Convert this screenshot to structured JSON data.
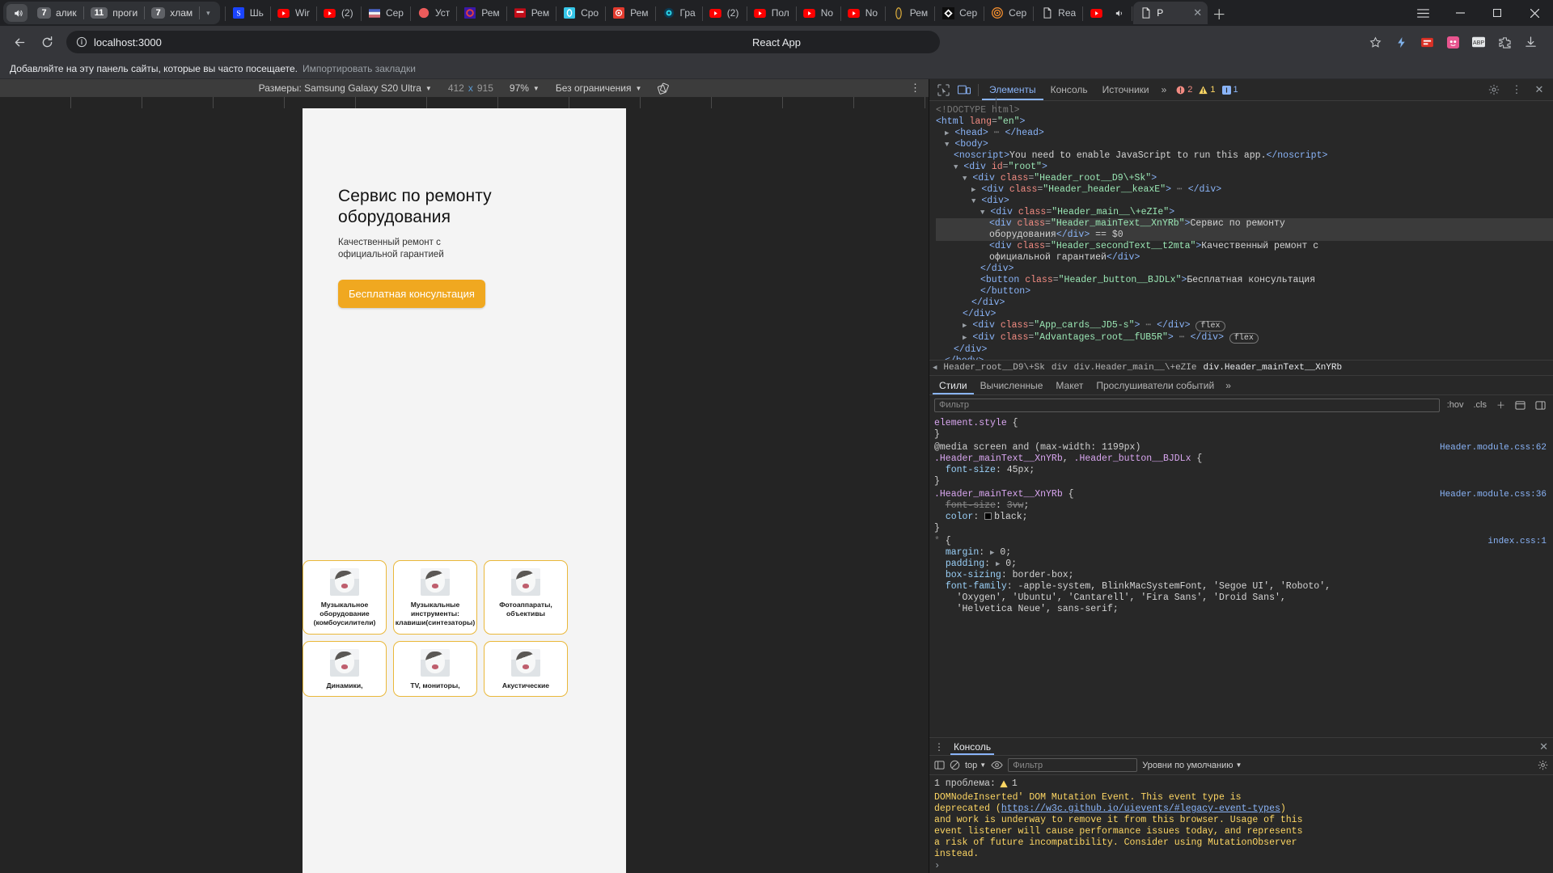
{
  "browser": {
    "tab_group": {
      "icon": "audio-playing-icon",
      "items": [
        {
          "count": "7",
          "label": "алик"
        },
        {
          "count": "11",
          "label": "проги"
        },
        {
          "count": "7",
          "label": "хлам"
        }
      ],
      "collapse_icon": "chevron-down-icon"
    },
    "tabs": [
      {
        "title": "Шь",
        "favicon": "s-blue-icon"
      },
      {
        "title": "Wir",
        "favicon": "youtube-icon"
      },
      {
        "title": "(2)",
        "favicon": "youtube-icon"
      },
      {
        "title": "Сер",
        "favicon": "flag-icon"
      },
      {
        "title": "Уст",
        "favicon": "red-dot-icon"
      },
      {
        "title": "Рем",
        "favicon": "purple-c-icon"
      },
      {
        "title": "Рем",
        "favicon": "red-square-icon"
      },
      {
        "title": "Сро",
        "favicon": "cyan-o-icon"
      },
      {
        "title": "Рем",
        "favicon": "red-circle-icon"
      },
      {
        "title": "Гра",
        "favicon": "teal-orb-icon"
      },
      {
        "title": "(2)",
        "favicon": "youtube-icon"
      },
      {
        "title": "Пол",
        "favicon": "youtube-icon"
      },
      {
        "title": "Nо",
        "favicon": "youtube-icon"
      },
      {
        "title": "Nо",
        "favicon": "youtube-icon"
      },
      {
        "title": "Рем",
        "favicon": "gold-ring-icon"
      },
      {
        "title": "Сер",
        "favicon": "black-diamond-icon"
      },
      {
        "title": "Сер",
        "favicon": "orange-target-icon"
      },
      {
        "title": "Rea",
        "favicon": "document-icon"
      },
      {
        "title": "",
        "favicon": "youtube-icon",
        "audio": "speaker-icon"
      }
    ],
    "active_tab": {
      "title": "Р",
      "favicon": "document-icon",
      "close_icon": "close-icon"
    },
    "new_tab_icon": "plus-icon",
    "window_controls": {
      "menu_icon": "hamburger-menu-icon",
      "minimize_icon": "minimize-icon",
      "maximize_icon": "maximize-icon",
      "close_icon": "close-window-icon"
    },
    "nav": {
      "back_icon": "arrow-left-icon",
      "reload_icon": "reload-icon",
      "info_icon": "page-info-icon",
      "url": "localhost:3000",
      "page_title": "React App",
      "right_icons": [
        "bookmark-star-icon",
        "extension-flash-icon",
        "extension-red-icon",
        "extension-pink-icon",
        "abp-icon",
        "extension-puzzle-icon",
        "download-icon"
      ]
    },
    "bookmark_bar": {
      "text": "Добавляйте на эту панель сайты, которые вы часто посещаете.",
      "link": "Импортировать закладки"
    }
  },
  "device_toolbar": {
    "dimensions_label": "Размеры: Samsung Galaxy S20 Ultra",
    "dimensions_caret": "chevron-down-icon",
    "width": "412",
    "x": "x",
    "height": "915",
    "zoom": "97%",
    "zoom_caret": "chevron-down-icon",
    "throttling": "Без ограничения",
    "throttling_caret": "chevron-down-icon",
    "rotate_icon": "rotate-device-icon",
    "kebab_icon": "more-options-icon"
  },
  "page": {
    "hero": {
      "title": "Сервис по ремонту оборудования",
      "subtitle": "Качественный ремонт с официальной гарантией",
      "cta_label": "Бесплатная консультация",
      "cta_color": "#f0a820"
    },
    "cards": [
      {
        "caption": "Музыкальное оборудование (комбоусилители)",
        "image": "cat-thumbnail"
      },
      {
        "caption": "Музыкальные инструменты: клавиши(синтезаторы)",
        "image": "cat-thumbnail"
      },
      {
        "caption": "Фотоаппараты, объективы",
        "image": "cat-thumbnail"
      },
      {
        "caption": "Динамики,",
        "image": "cat-thumbnail"
      },
      {
        "caption": "TV, мониторы,",
        "image": "cat-thumbnail"
      },
      {
        "caption": "Акустические",
        "image": "cat-thumbnail"
      }
    ]
  },
  "devtools": {
    "inspect_icon": "inspect-element-icon",
    "device_icon": "toggle-device-toolbar-icon",
    "tabs": [
      {
        "label": "Элементы",
        "selected": true
      },
      {
        "label": "Консоль",
        "selected": false
      },
      {
        "label": "Источники",
        "selected": false
      }
    ],
    "more_tabs_icon": "chevron-right-icon",
    "counts": {
      "errors": "2",
      "warnings": "1",
      "info": "1"
    },
    "settings_icon": "gear-icon",
    "kebab_icon": "more-options-icon",
    "close_icon": "close-icon",
    "dom": [
      {
        "indent": 0,
        "html": "<span class=\"gr\">&lt;!DOCTYPE html&gt;</span>"
      },
      {
        "indent": 0,
        "html": "<span class=\"tg\">&lt;html</span> <span class=\"at\">lang</span>=<span class=\"av\">\"en\"</span><span class=\"tg\">&gt;</span>"
      },
      {
        "indent": 1,
        "html": "<span class=\"caret\">▶</span> <span class=\"tg\">&lt;head&gt;</span> <span class=\"gr\">⋯</span> <span class=\"tg\">&lt;/head&gt;</span>"
      },
      {
        "indent": 1,
        "html": "<span class=\"caret\">▼</span> <span class=\"tg\">&lt;body&gt;</span>"
      },
      {
        "indent": 2,
        "html": "<span class=\"tg\">&lt;noscript&gt;</span><span class=\"tx\">You need to enable JavaScript to run this app.</span><span class=\"tg\">&lt;/noscript&gt;</span>"
      },
      {
        "indent": 2,
        "html": "<span class=\"caret\">▼</span> <span class=\"tg\">&lt;div</span> <span class=\"at\">id</span>=<span class=\"av\">\"root\"</span><span class=\"tg\">&gt;</span>"
      },
      {
        "indent": 3,
        "html": "<span class=\"caret\">▼</span> <span class=\"tg\">&lt;div</span> <span class=\"at\">class</span>=<span class=\"av\">\"Header_root__D9\\+Sk\"</span><span class=\"tg\">&gt;</span>"
      },
      {
        "indent": 4,
        "html": "<span class=\"caret\">▶</span> <span class=\"tg\">&lt;div</span> <span class=\"at\">class</span>=<span class=\"av\">\"Header_header__keaxE\"</span><span class=\"tg\">&gt;</span> <span class=\"gr\">⋯</span> <span class=\"tg\">&lt;/div&gt;</span>"
      },
      {
        "indent": 4,
        "html": "<span class=\"caret\">▼</span> <span class=\"tg\">&lt;div&gt;</span>"
      },
      {
        "indent": 5,
        "html": "<span class=\"caret\">▼</span> <span class=\"tg\">&lt;div</span> <span class=\"at\">class</span>=<span class=\"av\">\"Header_main__\\+eZIe\"</span><span class=\"tg\">&gt;</span>"
      },
      {
        "indent": 6,
        "selected": true,
        "html": "<span class=\"tg\">&lt;div</span> <span class=\"at\">class</span>=<span class=\"av\">\"Header_mainText__XnYRb\"</span><span class=\"tg\">&gt;</span><span class=\"tx\">Сервис по ремонту</span>"
      },
      {
        "indent": 6,
        "selected": true,
        "html": "<span class=\"tx\">оборудования</span><span class=\"tg\">&lt;/div&gt;</span> <span class=\"eqsel\">== $0</span>"
      },
      {
        "indent": 6,
        "html": "<span class=\"tg\">&lt;div</span> <span class=\"at\">class</span>=<span class=\"av\">\"Header_secondText__t2mta\"</span><span class=\"tg\">&gt;</span><span class=\"tx\">Качественный ремонт с</span>"
      },
      {
        "indent": 6,
        "html": "<span class=\"tx\">официальной гарантией</span><span class=\"tg\">&lt;/div&gt;</span>"
      },
      {
        "indent": 5,
        "html": "<span class=\"tg\">&lt;/div&gt;</span>"
      },
      {
        "indent": 5,
        "html": "<span class=\"tg\">&lt;button</span> <span class=\"at\">class</span>=<span class=\"av\">\"Header_button__BJDLx\"</span><span class=\"tg\">&gt;</span><span class=\"tx\">Бесплатная консультация</span>"
      },
      {
        "indent": 5,
        "html": "<span class=\"tg\">&lt;/button&gt;</span>"
      },
      {
        "indent": 4,
        "html": "<span class=\"tg\">&lt;/div&gt;</span>"
      },
      {
        "indent": 3,
        "html": "<span class=\"tg\">&lt;/div&gt;</span>"
      },
      {
        "indent": 3,
        "html": "<span class=\"caret\">▶</span> <span class=\"tg\">&lt;div</span> <span class=\"at\">class</span>=<span class=\"av\">\"App_cards__JD5-s\"</span><span class=\"tg\">&gt;</span> <span class=\"gr\">⋯</span> <span class=\"tg\">&lt;/div&gt;</span> <span class=\"flexchip\">flex</span>"
      },
      {
        "indent": 3,
        "html": "<span class=\"caret\">▶</span> <span class=\"tg\">&lt;div</span> <span class=\"at\">class</span>=<span class=\"av\">\"Advantages_root__fUB5R\"</span><span class=\"tg\">&gt;</span> <span class=\"gr\">⋯</span> <span class=\"tg\">&lt;/div&gt;</span> <span class=\"flexchip\">flex</span>"
      },
      {
        "indent": 2,
        "html": "<span class=\"tg\">&lt;/div&gt;</span>"
      },
      {
        "indent": 1,
        "html": "<span class=\"tg\">&lt;/body&gt;</span>"
      }
    ],
    "breadcrumbs": [
      "Header_root__D9\\+Sk",
      "div",
      "div.Header_main__\\+eZIe",
      "div.Header_mainText__XnYRb"
    ],
    "styles_tabs": [
      {
        "label": "Стили",
        "selected": true
      },
      {
        "label": "Вычисленные",
        "selected": false
      },
      {
        "label": "Макет",
        "selected": false
      },
      {
        "label": "Прослушиватели событий",
        "selected": false
      }
    ],
    "styles_more_icon": "chevron-right-icon",
    "filter_placeholder": "Фильтр",
    "filter_buttons": [
      ":hov",
      ".cls"
    ],
    "filter_icons": [
      "plus-icon",
      "new-style-rule-icon",
      "toggle-sidebar-icon"
    ],
    "css_rules": [
      {
        "source": "",
        "lines": [
          {
            "html": "<span class=\"sel-css\">element.style</span> {"
          },
          {
            "html": "}"
          }
        ]
      },
      {
        "source": "Header.module.css:62",
        "lines": [
          {
            "html": "<span class=\"media\">@media screen and (max-width: 1199px)</span>"
          },
          {
            "html": "<span class=\"sel-css\">.Header_mainText__XnYRb</span>, <span class=\"sel-css\">.Header_button__BJDLx</span> {"
          },
          {
            "html": "&nbsp;&nbsp;<span class=\"prop\">font-size</span>: <span class=\"val\">45px</span>;"
          },
          {
            "html": "}"
          }
        ]
      },
      {
        "source": "Header.module.css:36",
        "lines": [
          {
            "html": "<span class=\"sel-css\">.Header_mainText__XnYRb</span> {"
          },
          {
            "html": "&nbsp;&nbsp;<span class=\"strike\">font-size</span>: <span class=\"strike\">3vw</span>;"
          },
          {
            "html": "&nbsp;&nbsp;<span class=\"prop\">color</span>: <span class=\"swatch\" style=\"background:#000\"></span><span class=\"val\">black</span>;"
          },
          {
            "html": "}"
          }
        ]
      },
      {
        "source": "index.css:1",
        "lines": [
          {
            "html": "<span class=\"gr\">*</span> {"
          },
          {
            "html": "&nbsp;&nbsp;<span class=\"prop\">margin</span>: <span class=\"caret\">▶</span> <span class=\"val\">0</span>;"
          },
          {
            "html": "&nbsp;&nbsp;<span class=\"prop\">padding</span>: <span class=\"caret\">▶</span> <span class=\"val\">0</span>;"
          },
          {
            "html": "&nbsp;&nbsp;<span class=\"prop\">box-sizing</span>: <span class=\"val\">border-box</span>;"
          },
          {
            "html": "&nbsp;&nbsp;<span class=\"prop\">font-family</span>: <span class=\"val\">-apple-system, BlinkMacSystemFont, 'Segoe UI', 'Roboto',</span>"
          },
          {
            "html": "&nbsp;&nbsp;&nbsp;&nbsp;<span class=\"val\">'Oxygen', 'Ubuntu', 'Cantarell', 'Fira Sans', 'Droid Sans',</span>"
          },
          {
            "html": "&nbsp;&nbsp;&nbsp;&nbsp;<span class=\"val\">'Helvetica Neue', sans-serif;</span>"
          }
        ]
      }
    ],
    "console": {
      "kebab_icon": "more-options-icon",
      "tab_label": "Консоль",
      "close_icon": "close-icon",
      "sidebar_icon": "show-console-sidebar-icon",
      "clear_icon": "clear-console-icon",
      "context": "top",
      "context_caret": "chevron-down-icon",
      "eye_icon": "live-expression-icon",
      "filter_placeholder": "Фильтр",
      "levels": "Уровни по умолчанию",
      "levels_caret": "chevron-down-icon",
      "settings_icon": "gear-icon",
      "problems_text": "1 проблема:",
      "problems_count": "1",
      "problems_icon": "warning-icon",
      "message_lines": [
        "DOMNodeInserted' DOM Mutation Event. This event type is",
        "deprecated (https://w3c.github.io/uievents/#legacy-event-types)",
        "and work is underway to remove it from this browser. Usage of this",
        "event listener will cause performance issues today, and represents",
        "a risk of future incompatibility. Consider using MutationObserver",
        "instead."
      ],
      "message_link": "https://w3c.github.io/uievents/#legacy-event-types",
      "prompt": "›"
    }
  }
}
